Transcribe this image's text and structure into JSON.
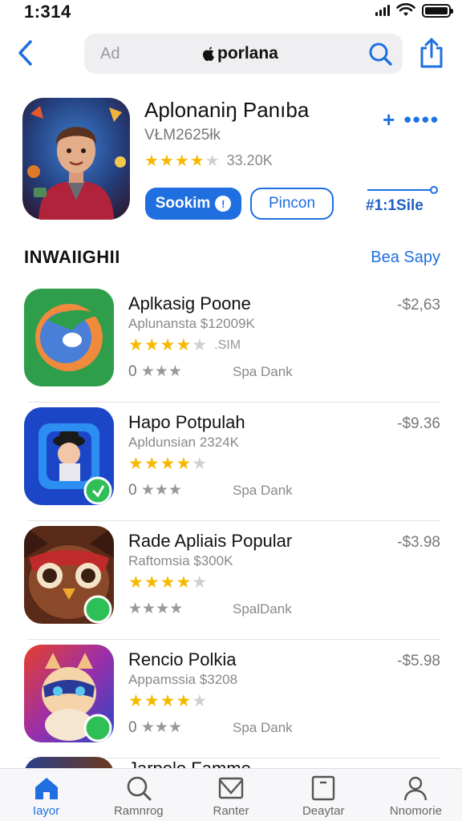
{
  "status": {
    "time": "1:314"
  },
  "search": {
    "ad_label": "Ad",
    "query": "porlana"
  },
  "featured": {
    "title": "Aplonaniŋ Panıba",
    "developer": "VŁM2625łk",
    "stars": 4,
    "rating_count": "33.20K",
    "more_label": "+ ••••",
    "get_label": "Sookim",
    "open_label": "Pincon",
    "price_label": "#1:1Sile"
  },
  "section": {
    "title": "INWAIIGHII",
    "see_all": "Bea Sapy"
  },
  "apps": [
    {
      "name": "Aplkasig Poone",
      "subtitle": "Aplunansta $12009K",
      "stars": 4,
      "rating_count": ".SIM",
      "meta_left": "0",
      "meta_right": "Spa Dank",
      "price": "-$2,63"
    },
    {
      "name": "Hapo Potpulah",
      "subtitle": "Apldunsian 2324K",
      "stars": 4,
      "rating_count": "",
      "meta_left": "0",
      "meta_right": "Spa Dank",
      "price": "-$9.36"
    },
    {
      "name": "Rade Apliais Popular",
      "subtitle": "Raftomsia $300K",
      "stars": 4,
      "rating_count": "",
      "meta_left": "",
      "meta_right": "SpalDank",
      "price": "-$3.98"
    },
    {
      "name": "Rencio Polkia",
      "subtitle": "Appamssia $3208",
      "stars": 4,
      "rating_count": "",
      "meta_left": "0",
      "meta_right": "Spa Dank",
      "price": "-$5.98"
    }
  ],
  "partial_app": {
    "name": "Jarpolo Famme"
  },
  "tabs": [
    {
      "label": "Iayor",
      "icon": "home-icon",
      "active": true
    },
    {
      "label": "Ramnrog",
      "icon": "search-icon",
      "active": false
    },
    {
      "label": "Ranter",
      "icon": "mail-icon",
      "active": false
    },
    {
      "label": "Deaytar",
      "icon": "tablet-icon",
      "active": false
    },
    {
      "label": "Nnomorie",
      "icon": "person-icon",
      "active": false
    }
  ],
  "colors": {
    "accent": "#1f6fe0",
    "star": "#f6b800",
    "text": "#111111",
    "muted": "#888888"
  }
}
